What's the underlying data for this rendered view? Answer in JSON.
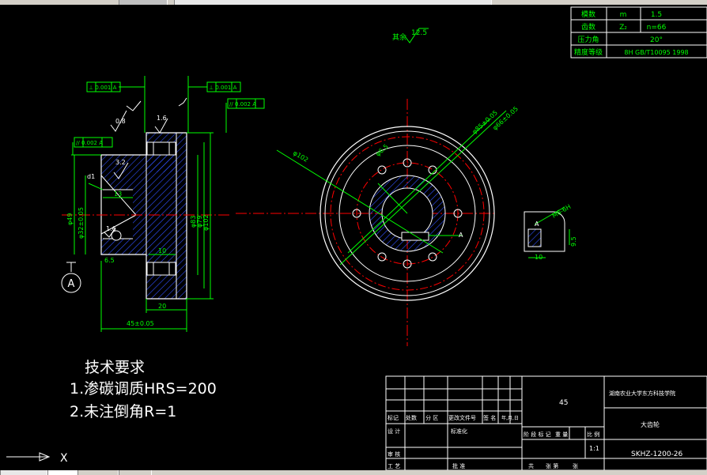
{
  "app": {
    "name": "CAD drawing viewport"
  },
  "params_table": {
    "rows": [
      {
        "name": "模数",
        "symbol": "m",
        "value": "1.5"
      },
      {
        "name": "齿数",
        "symbol": "Z₂",
        "value": "n=66"
      },
      {
        "name": "压力角",
        "symbol": "",
        "value": "20°"
      },
      {
        "name": "精度等级",
        "symbol": "",
        "value": "8H GB/T10095 1998"
      }
    ]
  },
  "roughness_note": {
    "label": "其余",
    "value": "12.5"
  },
  "section_view": {
    "tolerances": {
      "perp_left": "⊥ 0.001 A",
      "perp_right": "⊥ 0.001 A",
      "parallel_top": "// 0.002 A",
      "parallel_left": "// 0.002 A"
    },
    "roughness": [
      "0.8",
      "1.6",
      "3.2",
      "1.6"
    ],
    "dims": {
      "d1": "d1",
      "w13": "13",
      "w10": "10",
      "w20": "20",
      "total": "45±0.05",
      "d_left_a": "φ49",
      "d_left_b": "φ32±0.05",
      "d_right_a": "φ83",
      "d_right_b": "φ79",
      "d_right_c": "φ102",
      "hole": "6.5",
      "chamfer": "1.6"
    },
    "datum": "A"
  },
  "front_view": {
    "labels": {
      "d_outer": "φ102",
      "d_mid1": "φ85±0.05",
      "d_mid2": "φ66±0.05",
      "d_hole": "φ6.5",
      "view_a": "A"
    }
  },
  "detail_view": {
    "labels": {
      "letter": "A",
      "thread": "M6-6H",
      "h": "9.5",
      "w": "10"
    }
  },
  "tech_req": {
    "title": "技术要求",
    "items": [
      "1.渗碳调质HRS=200",
      "2.未注倒角R=1"
    ]
  },
  "title_block": {
    "material": "45",
    "school": "湖南农业大学东方科技学院",
    "part_name": "大齿轮",
    "drawing_no": "SKHZ-1200-26",
    "scale": "1:1",
    "headers": [
      "标记",
      "处数",
      "分 区",
      "更改文件号",
      "签 名",
      "年,月,日"
    ],
    "row_design": [
      "设 计",
      "标准化"
    ],
    "row_stage": [
      "阶 段 标 记",
      "重 量",
      "比 例"
    ],
    "row_check": "审 核",
    "row_process": "工 艺",
    "row_approve": "批 准",
    "row_sheets": [
      "共",
      "张 第",
      "张"
    ]
  },
  "ucs": {
    "x_label": "X"
  }
}
